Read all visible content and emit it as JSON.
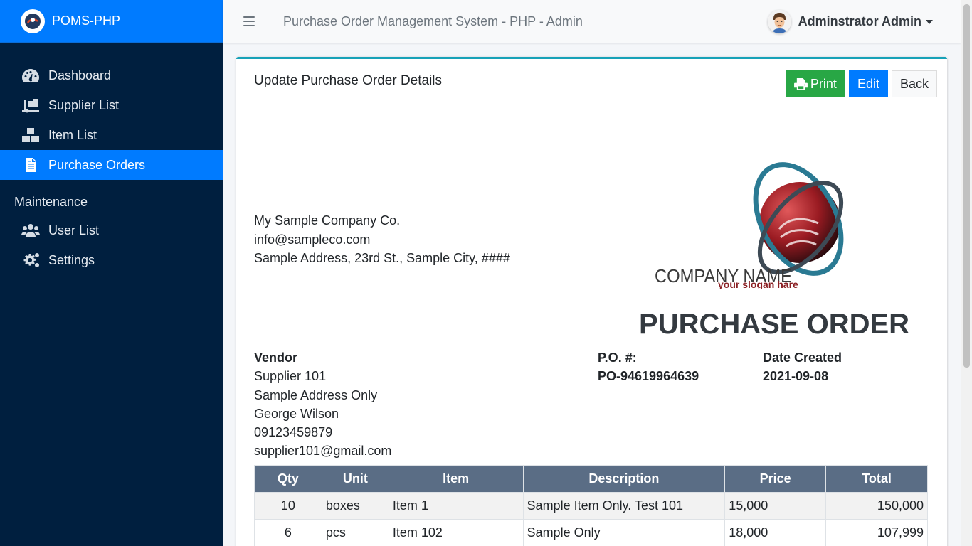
{
  "brand": {
    "name": "POMS-PHP",
    "logo_icon": "brand-logo-icon"
  },
  "sidebar": {
    "items": [
      {
        "label": "Dashboard",
        "icon": "tachometer-icon"
      },
      {
        "label": "Supplier List",
        "icon": "truck-loading-icon"
      },
      {
        "label": "Item List",
        "icon": "boxes-icon"
      },
      {
        "label": "Purchase Orders",
        "icon": "file-invoice-icon",
        "active": true
      }
    ],
    "maintenance_header": "Maintenance",
    "maintenance_items": [
      {
        "label": "User List",
        "icon": "users-icon"
      },
      {
        "label": "Settings",
        "icon": "cogs-icon"
      }
    ]
  },
  "topbar": {
    "title": "Purchase Order Management System - PHP - Admin",
    "user_name": "Adminstrator Admin"
  },
  "card": {
    "title": "Update Purchase Order Details",
    "print_label": "Print",
    "edit_label": "Edit",
    "back_label": "Back"
  },
  "company": {
    "name": "My Sample Company Co.",
    "email": "info@sampleco.com",
    "address": "Sample Address, 23rd St., Sample City, ####",
    "logo_name": "COMPANY NAME",
    "logo_slogan": "your slogan hare"
  },
  "po": {
    "heading": "PURCHASE ORDER",
    "vendor_label": "Vendor",
    "vendor": {
      "name": "Supplier 101",
      "address": "Sample Address Only",
      "contact": "George Wilson",
      "phone": "09123459879",
      "email": "supplier101@gmail.com"
    },
    "po_number_label": "P.O. #:",
    "po_number": "PO-94619964639",
    "date_label": "Date Created",
    "date": "2021-09-08"
  },
  "table": {
    "headers": [
      "Qty",
      "Unit",
      "Item",
      "Description",
      "Price",
      "Total"
    ],
    "rows": [
      [
        "10",
        "boxes",
        "Item 1",
        "Sample Item Only. Test 101",
        "15,000",
        "150,000"
      ],
      [
        "6",
        "pcs",
        "Item 102",
        "Sample Only",
        "18,000",
        "107,999"
      ]
    ]
  },
  "colors": {
    "sidebar": "#001f3f",
    "brand": "#007bff",
    "card_accent": "#17a2b8",
    "print_button": "#28a745",
    "edit_button": "#007bff",
    "table_header": "#5a6d85"
  }
}
